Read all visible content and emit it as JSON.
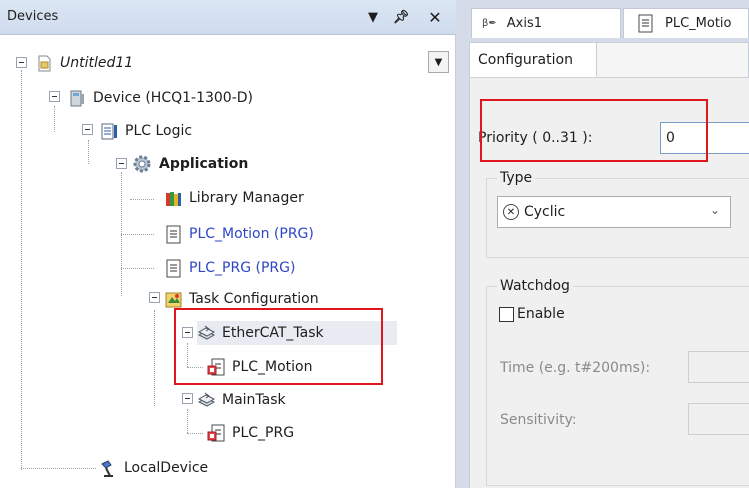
{
  "devices_panel": {
    "title": "Devices",
    "tree": [
      {
        "label": "Untitled11",
        "icon": "project-icon"
      },
      {
        "label": "Device (HCQ1-1300-D)",
        "icon": "device-icon"
      },
      {
        "label": "PLC Logic",
        "icon": "plc-logic-icon"
      },
      {
        "label": "Application",
        "icon": "application-gear-icon"
      },
      {
        "label": "Library Manager",
        "icon": "library-manager-icon"
      },
      {
        "label": "PLC_Motion (PRG)",
        "icon": "program-icon"
      },
      {
        "label": "PLC_PRG (PRG)",
        "icon": "program-icon"
      },
      {
        "label": "Task Configuration",
        "icon": "task-configuration-icon"
      },
      {
        "label": "EtherCAT_Task",
        "icon": "task-icon"
      },
      {
        "label": "PLC_Motion",
        "icon": "program-call-icon"
      },
      {
        "label": "MainTask",
        "icon": "task-icon"
      },
      {
        "label": "PLC_PRG",
        "icon": "program-call-icon"
      },
      {
        "label": "LocalDevice",
        "icon": "local-device-icon"
      }
    ]
  },
  "editor": {
    "tabs": [
      {
        "label": "Axis1",
        "icon": "axis-icon"
      },
      {
        "label": "PLC_Motio",
        "icon": "program-icon"
      }
    ],
    "sub_tab": "Configuration",
    "priority_label": "Priority ( 0..31 ):",
    "priority_value": "0",
    "type_group_label": "Type",
    "type_value": "Cyclic",
    "watchdog_group_label": "Watchdog",
    "enable_label": "Enable",
    "time_label": "Time (e.g. t#200ms):",
    "sensitivity_label": "Sensitivity:"
  },
  "colors": {
    "highlight_box": "#e0161d",
    "link_text": "#2f46c8"
  }
}
